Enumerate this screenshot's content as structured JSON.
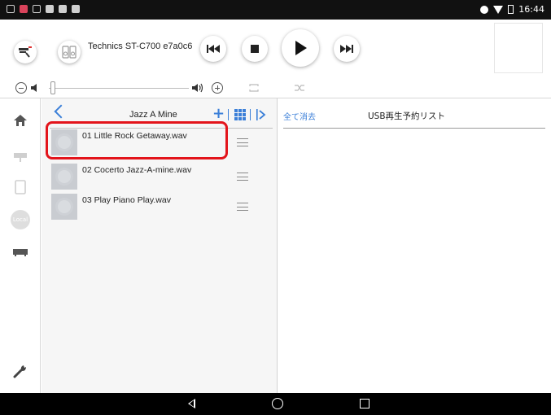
{
  "status_bar": {
    "time": "16:44"
  },
  "header": {
    "device_name": "Technics ST-C700 e7a0c6"
  },
  "list_panel": {
    "title": "Jazz A Mine",
    "tracks": [
      {
        "name": "01 Little Rock Getaway.wav",
        "highlighted": true
      },
      {
        "name": "02 Cocerto Jazz-A-mine.wav",
        "highlighted": false
      },
      {
        "name": "03 Play Piano Play.wav",
        "highlighted": false
      }
    ]
  },
  "queue_panel": {
    "clear_all_label": "全て消去",
    "title": "USB再生予約リスト"
  },
  "sidebar": {
    "local_label": "Local"
  },
  "colors": {
    "accent": "#3b7fd8",
    "highlight": "#e3141b"
  }
}
